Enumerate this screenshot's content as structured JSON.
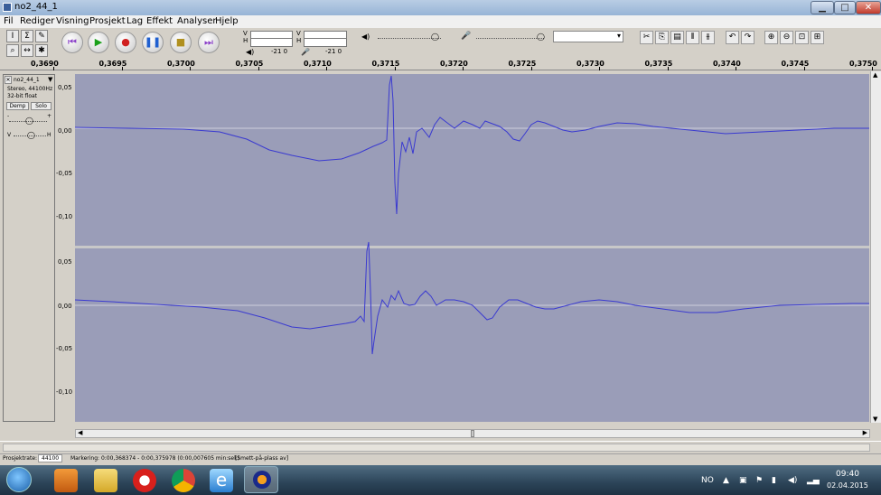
{
  "window": {
    "title": "no2_44_1"
  },
  "menu": [
    "Fil",
    "Rediger",
    "Visning",
    "Prosjekt",
    "Lag",
    "Effekt",
    "Analyser",
    "Hjelp"
  ],
  "toolbar": {
    "tools": [
      "I",
      "Σ",
      "✎",
      "⌕",
      "↔",
      "✱"
    ],
    "meter_play_label": "V\nH",
    "meter_rec_label": "V\nH",
    "meter_db_play": "-21  0",
    "meter_db_rec": "-21  0"
  },
  "ruler": {
    "ticks": [
      "0,3690",
      "0,3695",
      "0,3700",
      "0,3705",
      "0,3710",
      "0,3715",
      "0,3720",
      "0,3725",
      "0,3730",
      "0,3735",
      "0,3740",
      "0,3745",
      "0,3750"
    ]
  },
  "track": {
    "name": "no2_44_1",
    "info1": "Stereo, 44100Hz",
    "info2": "32-bit float",
    "mute_label": "Demp",
    "solo_label": "Solo",
    "gain_minus": "-",
    "gain_plus": "+",
    "pan_left": "V",
    "pan_right": "H",
    "scale_labels": [
      "0,05",
      "0,00",
      "-0,05",
      "-0,10"
    ]
  },
  "status": {
    "project_rate_label": "Prosjektrate:",
    "project_rate_value": "44100",
    "selection": "Markering: 0:00,368374 - 0:00,375978 (0:00,007605 min:sek)",
    "snap": "[Smett-på-plass av]"
  },
  "taskbar": {
    "lang": "NO",
    "time": "09:40",
    "date": "02.04.2015"
  },
  "colors": {
    "wave_bg": "#9a9db8",
    "wave_line": "#3a3ad0",
    "center_line": "#ffffff"
  }
}
